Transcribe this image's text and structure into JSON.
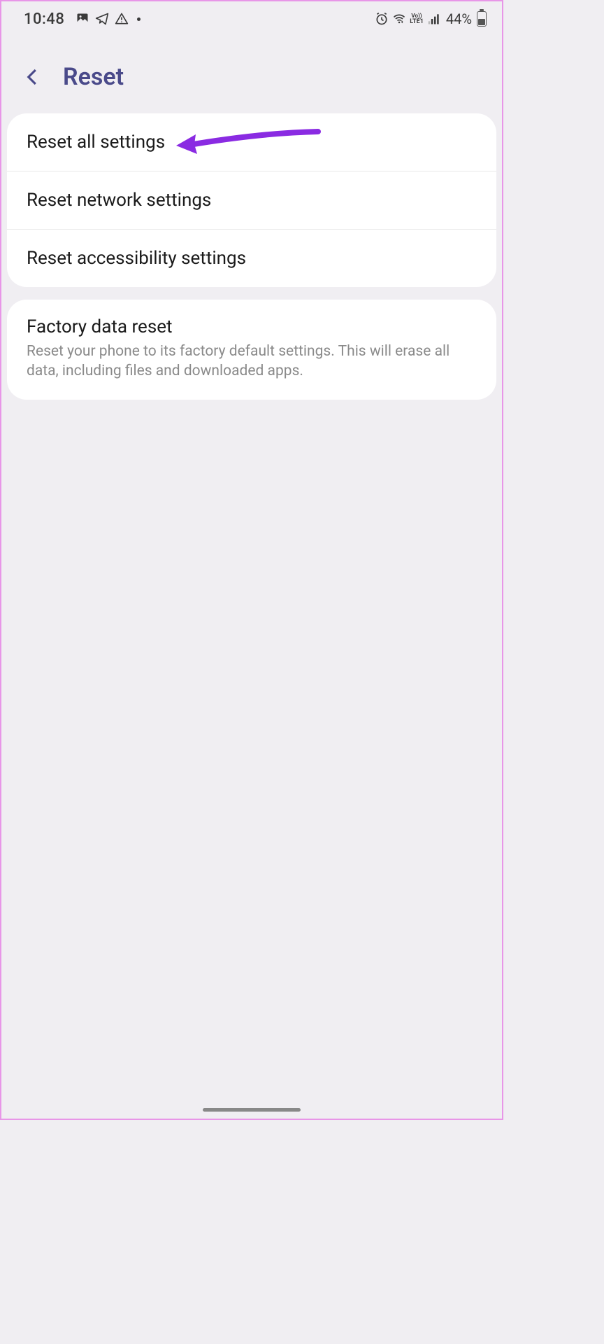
{
  "status": {
    "time": "10:48",
    "battery": "44%"
  },
  "header": {
    "title": "Reset"
  },
  "group1": {
    "items": [
      {
        "title": "Reset all settings"
      },
      {
        "title": "Reset network settings"
      },
      {
        "title": "Reset accessibility settings"
      }
    ]
  },
  "group2": {
    "items": [
      {
        "title": "Factory data reset",
        "desc": "Reset your phone to its factory default settings. This will erase all data, including files and downloaded apps."
      }
    ]
  },
  "colors": {
    "accent": "#4a4a8a",
    "annotation": "#8a2be2"
  }
}
